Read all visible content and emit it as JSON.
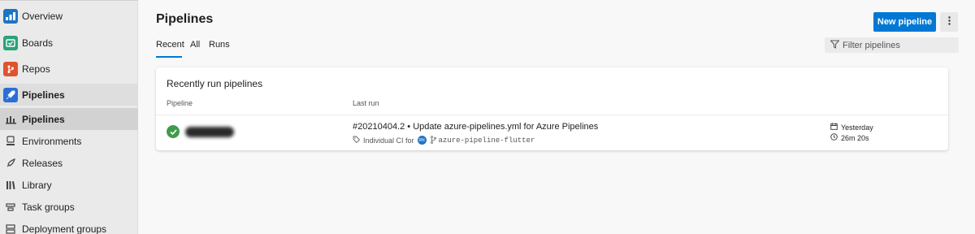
{
  "sidebar": {
    "items": [
      {
        "label": "Overview",
        "icon": "overview-icon"
      },
      {
        "label": "Boards",
        "icon": "boards-icon"
      },
      {
        "label": "Repos",
        "icon": "repos-icon"
      },
      {
        "label": "Pipelines",
        "icon": "pipelines-icon"
      },
      {
        "label": "Pipelines",
        "icon": "pipelines-sub-icon"
      },
      {
        "label": "Environments",
        "icon": "environments-icon"
      },
      {
        "label": "Releases",
        "icon": "rocket-icon"
      },
      {
        "label": "Library",
        "icon": "library-icon"
      },
      {
        "label": "Task groups",
        "icon": "task-groups-icon"
      },
      {
        "label": "Deployment groups",
        "icon": "deployment-groups-icon"
      }
    ]
  },
  "header": {
    "title": "Pipelines",
    "new_button": "New pipeline",
    "more_icon": "more-vertical-icon"
  },
  "tabs": [
    {
      "label": "Recent",
      "active": true
    },
    {
      "label": "All",
      "active": false
    },
    {
      "label": "Runs",
      "active": false
    }
  ],
  "filter": {
    "placeholder": "Filter pipelines",
    "icon": "filter-icon"
  },
  "card": {
    "title": "Recently run pipelines",
    "columns": [
      "Pipeline",
      "Last run"
    ],
    "rows": [
      {
        "status": "succeeded",
        "run_title": "#20210404.2 • Update azure-pipelines.yml for Azure Pipelines",
        "trigger": "Individual CI for",
        "avatar_initials": "RN",
        "branch": "azure-pipeline-flutter",
        "when": "Yesterday",
        "duration": "26m 20s"
      }
    ]
  },
  "colors": {
    "accent": "#0078d4",
    "success": "#3f9c4a"
  }
}
